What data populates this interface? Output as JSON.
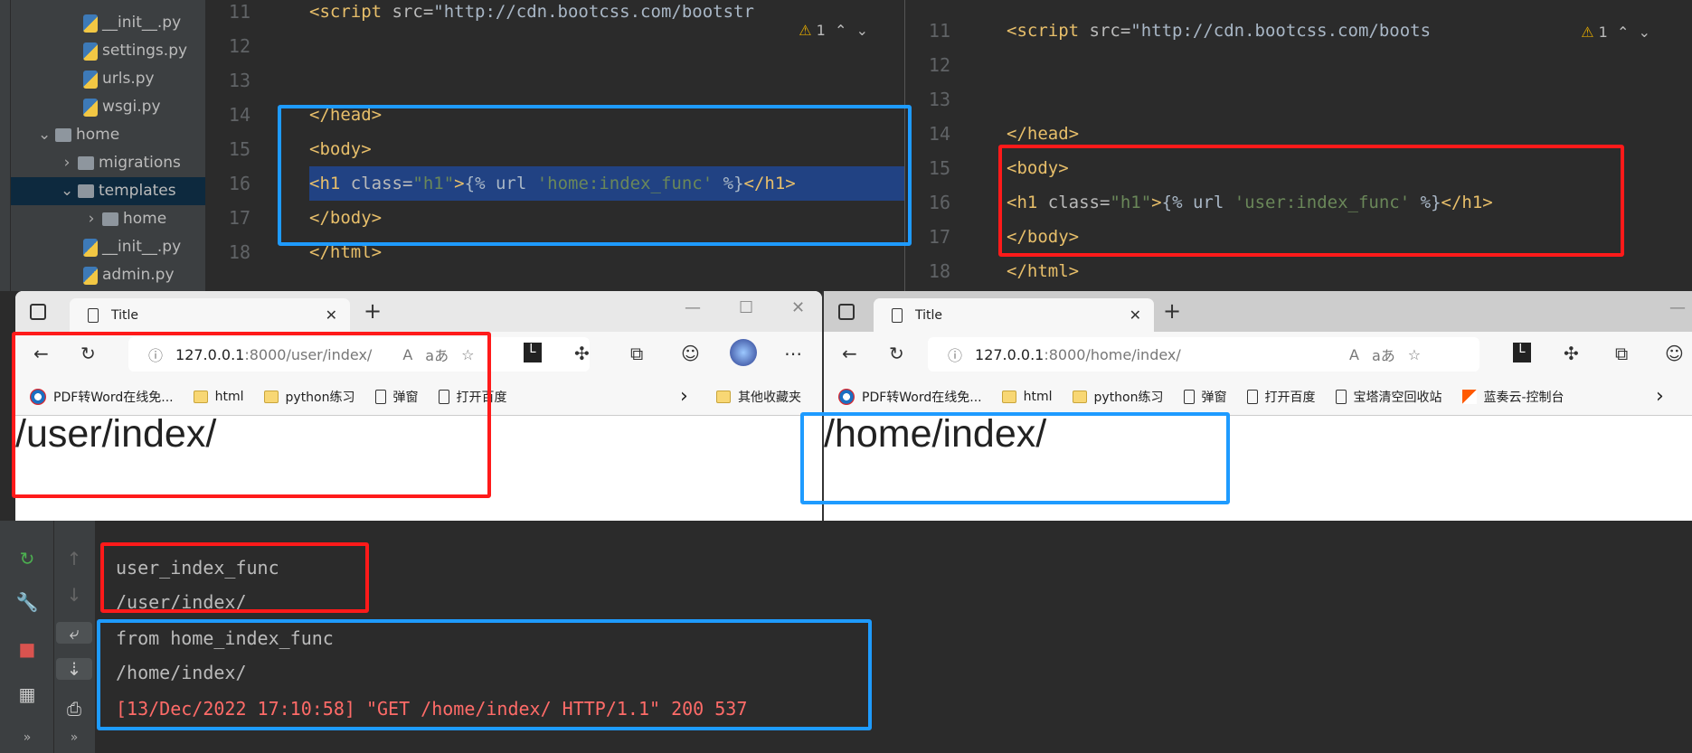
{
  "project_tree": [
    {
      "label": "__init__.py",
      "type": "py"
    },
    {
      "label": "settings.py",
      "type": "py"
    },
    {
      "label": "urls.py",
      "type": "py"
    },
    {
      "label": "wsgi.py",
      "type": "py"
    },
    {
      "label": "home",
      "type": "module"
    },
    {
      "label": "migrations",
      "type": "folder"
    },
    {
      "label": "templates",
      "type": "folder"
    },
    {
      "label": "home",
      "type": "folder"
    },
    {
      "label": "__init__.py",
      "type": "py"
    },
    {
      "label": "admin.py",
      "type": "py"
    }
  ],
  "editor_left": {
    "warning_count": "1",
    "lines": [
      {
        "n": "11",
        "code": "<script src=\"http://cdn.bootcss.com/bootstr"
      },
      {
        "n": "12",
        "code": ""
      },
      {
        "n": "13",
        "code": ""
      },
      {
        "n": "14",
        "code": "</head>"
      },
      {
        "n": "15",
        "code": "<body>"
      },
      {
        "n": "16",
        "code": "<h1 class=\"h1\">{% url 'home:index_func' %}</h1>"
      },
      {
        "n": "17",
        "code": "</body>"
      },
      {
        "n": "18",
        "code": "</html>"
      }
    ]
  },
  "editor_right": {
    "warning_count": "1",
    "lines": [
      {
        "n": "11",
        "code": "<script src=\"http://cdn.bootcss.com/boots"
      },
      {
        "n": "12",
        "code": ""
      },
      {
        "n": "13",
        "code": ""
      },
      {
        "n": "14",
        "code": "</head>"
      },
      {
        "n": "15",
        "code": "<body>"
      },
      {
        "n": "16",
        "code": "<h1 class=\"h1\">{% url 'user:index_func' %}</h1>"
      },
      {
        "n": "17",
        "code": "</body>"
      },
      {
        "n": "18",
        "code": "</html>"
      }
    ]
  },
  "browser_left": {
    "tab_title": "Title",
    "url_host": "127.0.0.1",
    "url_rest": ":8000/user/index/",
    "bookmarks": [
      "PDF转Word在线免...",
      "html",
      "python练习",
      "弹窗",
      "打开百度"
    ],
    "other_bookmarks": "其他收藏夹",
    "heading": "/user/index/"
  },
  "browser_right": {
    "tab_title": "Title",
    "url_host": "127.0.0.1",
    "url_rest": ":8000/home/index/",
    "bookmarks": [
      "PDF转Word在线免...",
      "html",
      "python练习",
      "弹窗",
      "打开百度",
      "宝塔清空回收站",
      "蓝奏云-控制台"
    ],
    "heading": "/home/index/"
  },
  "console": {
    "lines": [
      {
        "text": "user_index_func",
        "type": "out"
      },
      {
        "text": "/user/index/",
        "type": "out"
      },
      {
        "text": "from home_index_func",
        "type": "out"
      },
      {
        "text": "/home/index/",
        "type": "out"
      },
      {
        "text": "[13/Dec/2022 17:10:58] \"GET /home/index/ HTTP/1.1\" 200 537",
        "type": "err"
      }
    ]
  },
  "colors": {
    "highlight_red": "#ff1a1a",
    "highlight_blue": "#1e9bff",
    "tag": "#e8bf6a",
    "string": "#6a8759",
    "selection": "#214283",
    "error_text": "#ff6b68"
  }
}
